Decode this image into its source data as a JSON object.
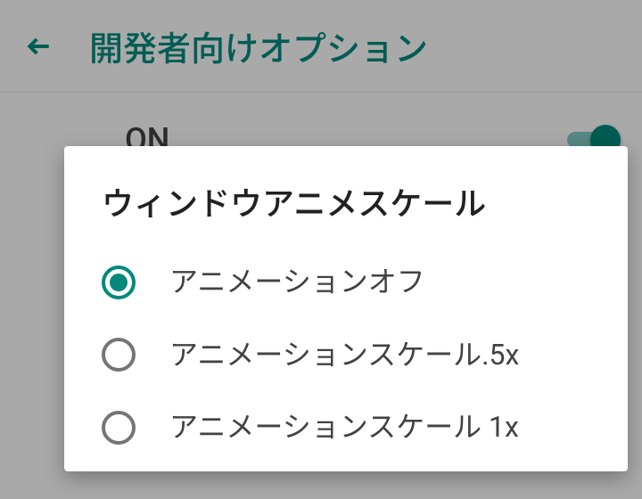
{
  "header": {
    "title": "開発者向けオプション"
  },
  "content": {
    "toggle": {
      "label": "ON",
      "state": true
    }
  },
  "dialog": {
    "title": "ウィンドウアニメスケール",
    "options": [
      {
        "label": "アニメーションオフ",
        "selected": true
      },
      {
        "label": "アニメーションスケール.5x",
        "selected": false
      },
      {
        "label": "アニメーションスケール 1x",
        "selected": false
      }
    ]
  },
  "colors": {
    "accent": "#00897b"
  }
}
